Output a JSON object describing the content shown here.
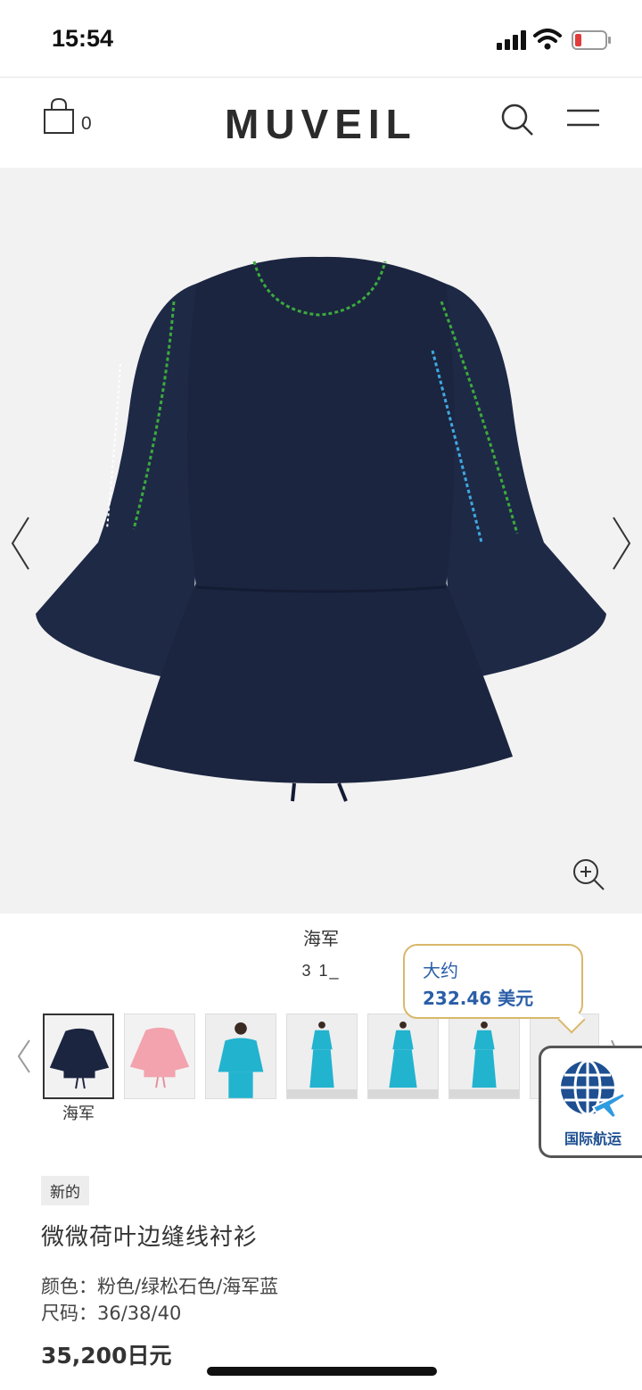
{
  "status_bar": {
    "time": "15:54"
  },
  "header": {
    "brand": "MUVEIL",
    "cart_count": "0"
  },
  "gallery": {
    "color_name": "海军",
    "page_indicator": "3 1_",
    "selected_thumb_label": "海军"
  },
  "price_bubble": {
    "label": "大约",
    "price": "232.46 美元"
  },
  "intl_badge": {
    "text": "国际航运"
  },
  "product": {
    "badge": "新的",
    "title": "微微荷叶边缝线衬衫",
    "colors": "颜色：粉色/绿松石色/海军蓝",
    "sizes": "尺码：36/38/40",
    "price": "35,200日元"
  },
  "colors": {
    "navy": "#1b2540",
    "pink": "#f2a3ae",
    "turquoise": "#22b3cf",
    "bubble_border": "#d9b86a",
    "bubble_text": "#2a5ea8"
  }
}
